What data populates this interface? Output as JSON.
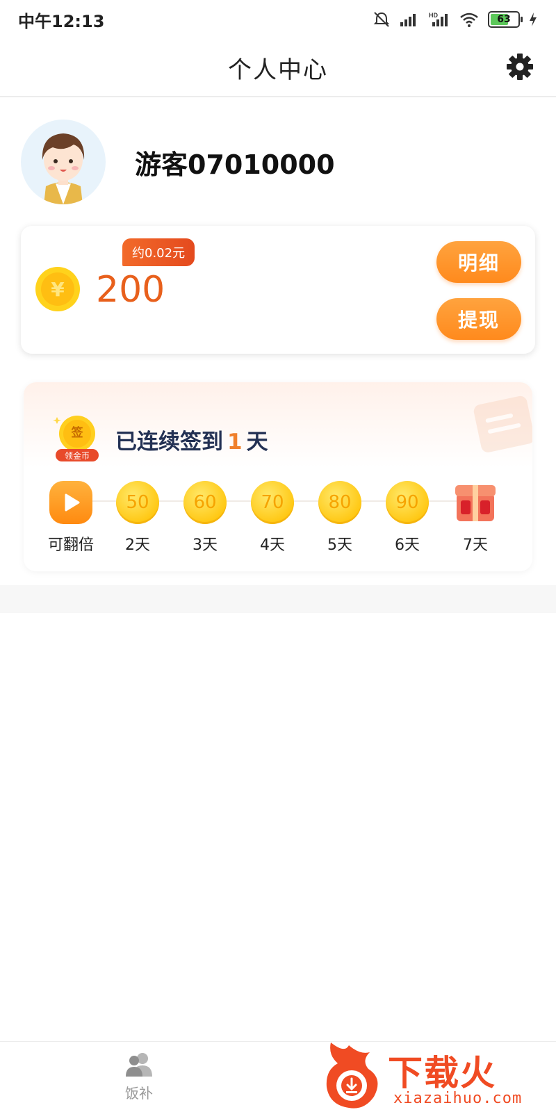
{
  "status_bar": {
    "time": "中午12:13",
    "battery": "63"
  },
  "header": {
    "title": "个人中心"
  },
  "profile": {
    "username": "游客07010000"
  },
  "coins": {
    "amount": "200",
    "approx": "约0.02元",
    "detail_label": "明细",
    "withdraw_label": "提现"
  },
  "sign_in": {
    "prefix": "已连续签到",
    "count": "1",
    "suffix": "天",
    "badge_top": "签",
    "badge_bottom": "领金币",
    "days": [
      {
        "kind": "play",
        "label": "可翻倍"
      },
      {
        "kind": "coin",
        "value": "50",
        "label": "2天"
      },
      {
        "kind": "coin",
        "value": "60",
        "label": "3天"
      },
      {
        "kind": "coin",
        "value": "70",
        "label": "4天"
      },
      {
        "kind": "coin",
        "value": "80",
        "label": "5天"
      },
      {
        "kind": "coin",
        "value": "90",
        "label": "6天"
      },
      {
        "kind": "gift",
        "label": "7天"
      }
    ]
  },
  "bottom_nav": {
    "items": [
      {
        "label": "饭补"
      }
    ]
  },
  "watermark": {
    "main": "下载火",
    "sub": "xiazaihuo.com"
  },
  "colors": {
    "accent": "#ff8a1d",
    "coin_text": "#e8601c",
    "title_text": "#233154"
  }
}
